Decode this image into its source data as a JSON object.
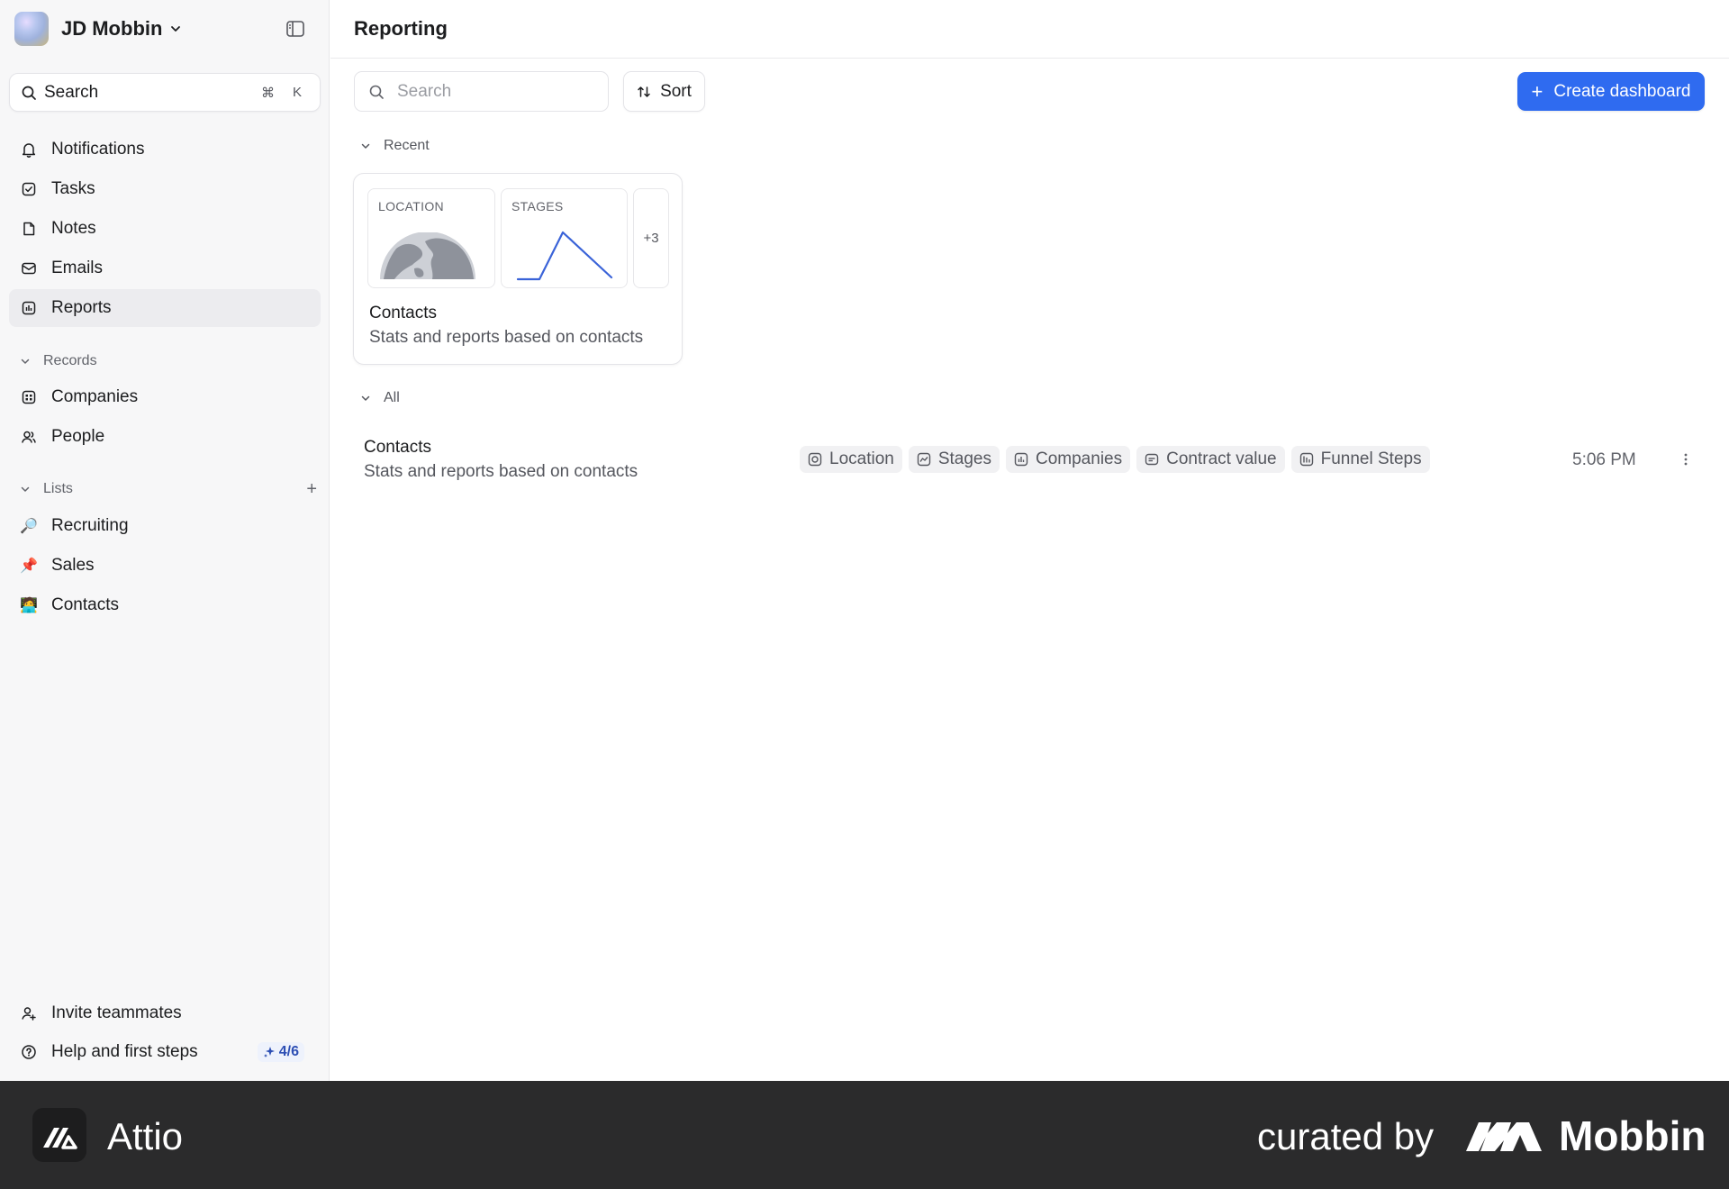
{
  "workspace": {
    "name": "JD Mobbin"
  },
  "sidebar": {
    "search": {
      "label": "Search",
      "key1": "⌘",
      "key2": "K"
    },
    "nav": [
      {
        "label": "Notifications",
        "icon": "bell-icon"
      },
      {
        "label": "Tasks",
        "icon": "checkbox-icon"
      },
      {
        "label": "Notes",
        "icon": "note-icon"
      },
      {
        "label": "Emails",
        "icon": "mail-icon"
      },
      {
        "label": "Reports",
        "icon": "report-icon",
        "active": true
      }
    ],
    "records_section": "Records",
    "records": [
      {
        "label": "Companies",
        "icon": "building-icon"
      },
      {
        "label": "People",
        "icon": "people-icon"
      }
    ],
    "lists_section": "Lists",
    "lists": [
      {
        "label": "Recruiting",
        "emoji": "🔎"
      },
      {
        "label": "Sales",
        "emoji": "📌"
      },
      {
        "label": "Contacts",
        "emoji": "🧑‍💻"
      }
    ],
    "invite": "Invite teammates",
    "help": "Help and first steps",
    "help_badge": "4/6"
  },
  "main": {
    "title": "Reporting",
    "search_placeholder": "Search",
    "sort_label": "Sort",
    "create_label": "Create dashboard",
    "recent_label": "Recent",
    "all_label": "All",
    "recent_card": {
      "thumb1": "LOCATION",
      "thumb2": "STAGES",
      "more": "+3",
      "title": "Contacts",
      "description": "Stats and reports based on contacts"
    },
    "row": {
      "title": "Contacts",
      "description": "Stats and reports based on contacts",
      "chips": [
        "Location",
        "Stages",
        "Companies",
        "Contract value",
        "Funnel Steps"
      ],
      "time": "5:06 PM"
    }
  },
  "footer": {
    "brand": "Attio",
    "curated": "curated by",
    "mobbin": "Mobbin"
  },
  "colors": {
    "accent": "#2f6bf0",
    "sidebar_bg": "#f7f7f8",
    "footer_bg": "#2b2b2c",
    "chart_line": "#3a63d8"
  }
}
